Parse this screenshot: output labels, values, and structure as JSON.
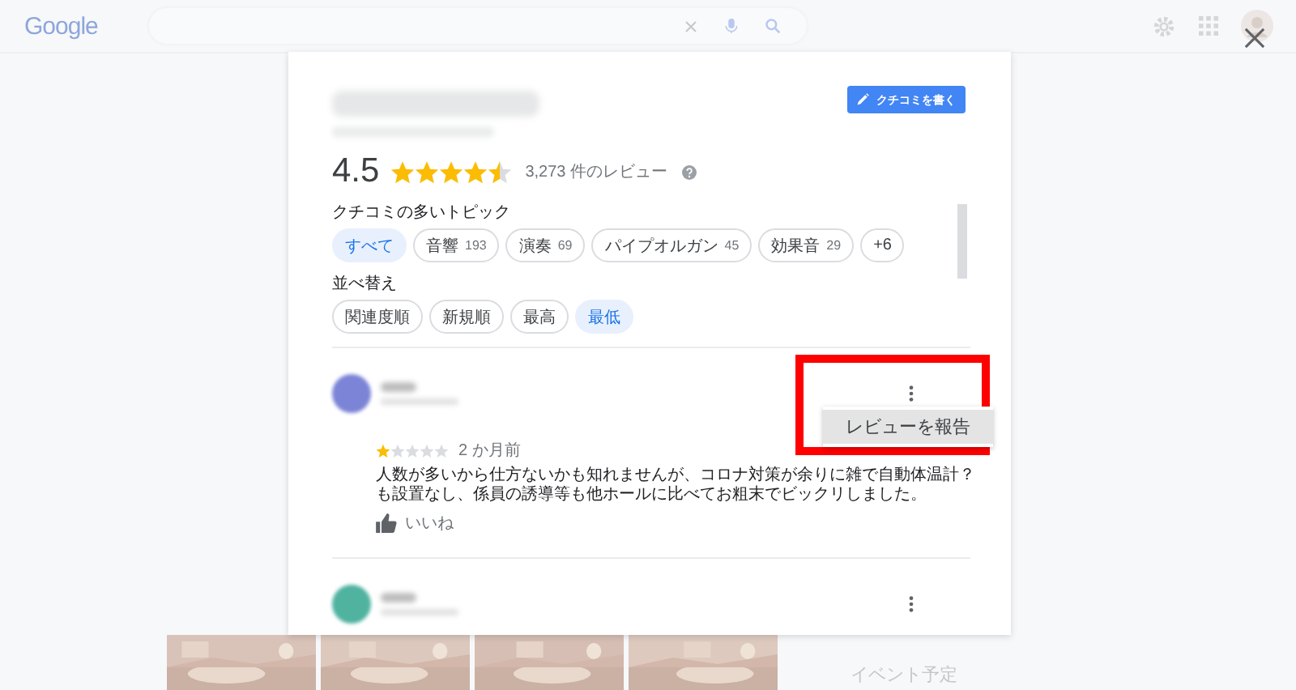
{
  "background_page": {
    "logo": "Google",
    "section_heading": "イベント予定"
  },
  "dialog": {
    "write_review_button": "クチコミを書く",
    "rating": "4.5",
    "stars": 4.5,
    "review_count": "3,273 件のレビュー",
    "topics_heading": "クチコミの多いトピック",
    "topics": [
      {
        "label": "すべて",
        "selected": true
      },
      {
        "label": "音響",
        "count": "193",
        "selected": false
      },
      {
        "label": "演奏",
        "count": "69",
        "selected": false
      },
      {
        "label": "パイプオルガン",
        "count": "45",
        "selected": false
      },
      {
        "label": "効果音",
        "count": "29",
        "selected": false
      },
      {
        "label": "+6",
        "selected": false
      }
    ],
    "sort_heading": "並べ替え",
    "sort_options": [
      {
        "label": "関連度順",
        "selected": false
      },
      {
        "label": "新規順",
        "selected": false
      },
      {
        "label": "最高",
        "selected": false
      },
      {
        "label": "最低",
        "selected": true
      }
    ],
    "reviews": [
      {
        "color": "#7b84d6",
        "stars": 1,
        "time": "2 か月前",
        "text": "人数が多いから仕方ないかも知れませんが、コロナ対策が余りに雑で自動体温計？も設置なし、係員の誘導等も他ホールに比べてお粗末でビックリしました。",
        "like_label": "いいね",
        "menu_item": "レビューを報告",
        "highlighted": true
      },
      {
        "color": "#4fb3a0",
        "highlighted": false
      }
    ]
  }
}
